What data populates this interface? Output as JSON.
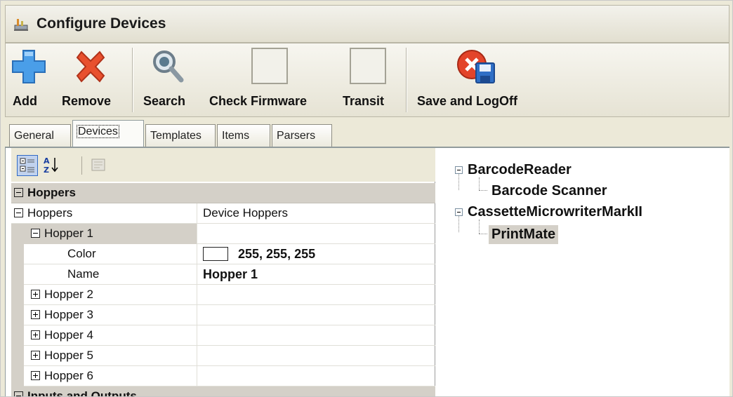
{
  "window": {
    "title": "Configure Devices"
  },
  "toolbar": {
    "add_label": "Add",
    "remove_label": "Remove",
    "search_label": "Search",
    "check_firmware_label": "Check Firmware",
    "transit_label": "Transit",
    "save_logoff_label": "Save and LogOff"
  },
  "tabs": [
    {
      "label": "General"
    },
    {
      "label": "Devices",
      "active": true
    },
    {
      "label": "Templates"
    },
    {
      "label": "Items"
    },
    {
      "label": "Parsers"
    }
  ],
  "property_grid": {
    "toolbar_icons": [
      "categorized-icon",
      "alphabetical-icon",
      "property-pages-icon"
    ],
    "category_hoppers": "Hoppers",
    "rows": [
      {
        "name": "Hoppers",
        "value": "Device Hoppers"
      },
      {
        "name": "Hopper 1",
        "value": ""
      },
      {
        "name": "Color",
        "value": "255, 255, 255"
      },
      {
        "name": "Name",
        "value": "Hopper 1"
      },
      {
        "name": "Hopper 2",
        "value": ""
      },
      {
        "name": "Hopper 3",
        "value": ""
      },
      {
        "name": "Hopper 4",
        "value": ""
      },
      {
        "name": "Hopper 5",
        "value": ""
      },
      {
        "name": "Hopper 6",
        "value": ""
      }
    ],
    "category_next": "Inputs and Outputs"
  },
  "device_tree": {
    "nodes": [
      {
        "label": "BarcodeReader",
        "children": [
          {
            "label": "Barcode Scanner"
          }
        ]
      },
      {
        "label": "CassetteMicrowriterMarkII",
        "children": [
          {
            "label": "PrintMate",
            "selected": true
          }
        ]
      }
    ]
  },
  "colors": {
    "selection_bg": "#d4d0c8",
    "accent_blue": "#316ac5",
    "remove_red": "#e03c1f",
    "add_blue": "#3c8fe0"
  }
}
